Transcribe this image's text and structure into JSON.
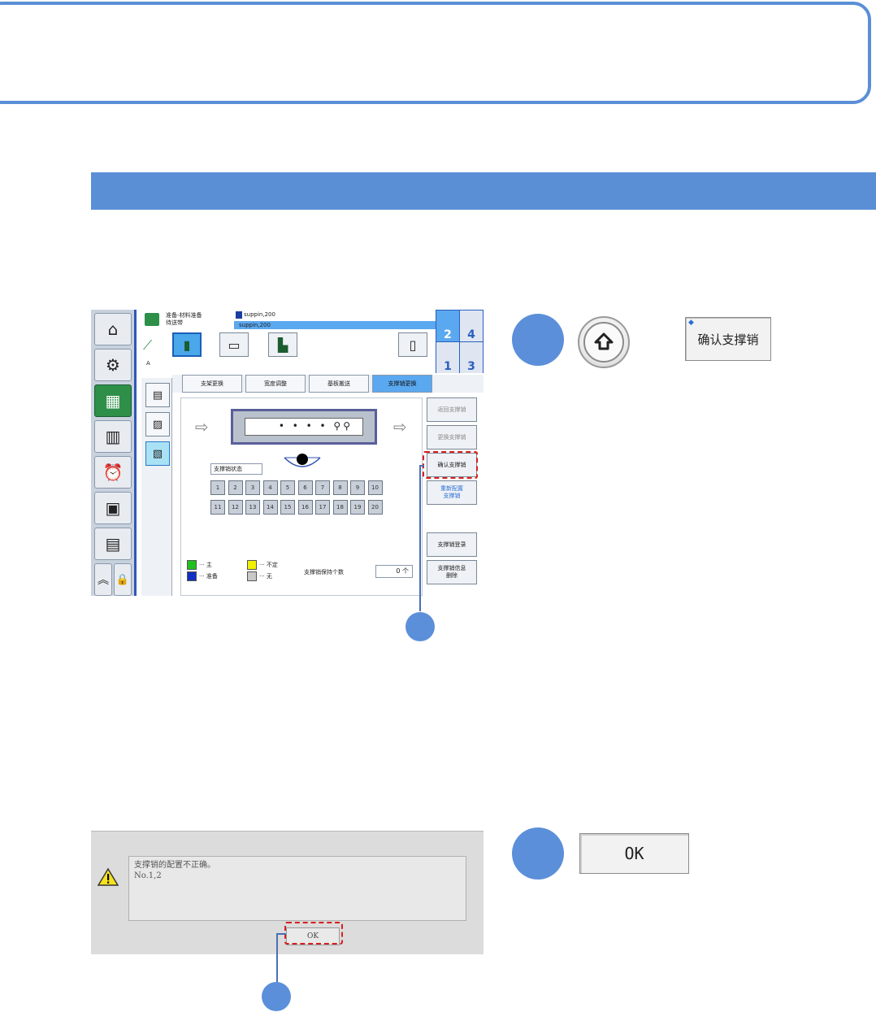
{
  "screen1": {
    "header": {
      "status_line1": "准备-材料准备",
      "status_line2": "待送带",
      "program_line1": "suppin,200",
      "program_line2": "suppin,200",
      "conveyor_numbers": [
        "2",
        "4",
        "1",
        "3"
      ]
    },
    "tabs": [
      "支架更换",
      "宽度调整",
      "基板搬送",
      "支撑销更换"
    ],
    "selected_tab": "支撑销更换",
    "status_label": "支撑销状态",
    "pins_row1": [
      "1",
      "2",
      "3",
      "4",
      "5",
      "6",
      "7",
      "8",
      "9",
      "10"
    ],
    "pins_row2": [
      "11",
      "12",
      "13",
      "14",
      "15",
      "16",
      "17",
      "18",
      "19",
      "20"
    ],
    "board_dots": "• • • • ⚲⚲",
    "right_buttons": {
      "return_pins": "返回支撑销",
      "replace_pins": "更换支撑销",
      "confirm_pins": "确认支撑销",
      "reconfigure_line1": "重新配置",
      "reconfigure_line2": "支撑销",
      "register_pins": "支撑销登录",
      "delete_info_line1": "支撑销信息",
      "delete_info_line2": "删除"
    },
    "legend": {
      "main": "··· 主",
      "standby": "··· 准备",
      "undefined": "··· 不定",
      "none": "··· 无"
    },
    "hold_count_label": "支撑销保持个数",
    "hold_count_value": "0 个",
    "small_label_a": "A"
  },
  "step1": {
    "confirm_button": "确认支撑销"
  },
  "screen2": {
    "message_line1": "支撑销的配置不正确。",
    "message_line2": "No.1,2",
    "ok_label": "OK"
  },
  "step2": {
    "ok_button": "OK"
  },
  "colors": {
    "accent_blue": "#5a8fd6",
    "callout_blue": "#5b8fd9",
    "highlight_red": "#d42020",
    "legend_main": "#20c020",
    "legend_standby": "#1030c0",
    "legend_undefined": "#f0f000",
    "legend_none": "#c8c8c8"
  }
}
